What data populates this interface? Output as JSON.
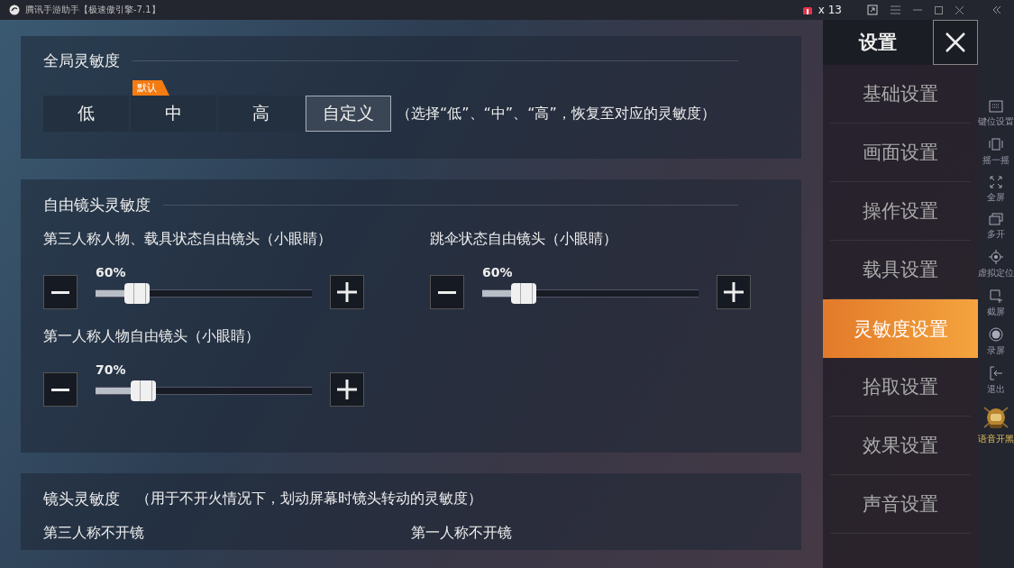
{
  "titlebar": {
    "title": "腾讯手游助手【极速傲引擎-7.1】",
    "gift_count": "x 13"
  },
  "global_sensitivity": {
    "title": "全局灵敏度",
    "hint": "（选择“低”、“中”、“高”，恢复至对应的灵敏度）",
    "options": [
      {
        "label": "低",
        "selected": false
      },
      {
        "label": "中",
        "selected": false,
        "badge": "默认"
      },
      {
        "label": "高",
        "selected": false
      },
      {
        "label": "自定义",
        "selected": true
      }
    ]
  },
  "free_camera": {
    "title": "自由镜头灵敏度",
    "sliders": [
      {
        "label": "第三人称人物、载具状态自由镜头（小眼睛）",
        "reading": "60%",
        "level": 0.19
      },
      {
        "label": "跳伞状态自由镜头（小眼睛）",
        "reading": "60%",
        "level": 0.19
      },
      {
        "label": "第一人称人物自由镜头（小眼睛）",
        "reading": "70%",
        "level": 0.22
      }
    ]
  },
  "camera": {
    "title": "镜头灵敏度",
    "note": "（用于不开火情况下，划动屏幕时镜头转动的灵敏度）",
    "columns": [
      "第三人称不开镜",
      "第一人称不开镜"
    ]
  },
  "settings_menu": {
    "title": "设置",
    "items": [
      {
        "label": "基础设置",
        "selected": false
      },
      {
        "label": "画面设置",
        "selected": false
      },
      {
        "label": "操作设置",
        "selected": false
      },
      {
        "label": "载具设置",
        "selected": false
      },
      {
        "label": "灵敏度设置",
        "selected": true
      },
      {
        "label": "拾取设置",
        "selected": false
      },
      {
        "label": "效果设置",
        "selected": false
      },
      {
        "label": "声音设置",
        "selected": false
      }
    ]
  },
  "toolbar": [
    {
      "label": "键位设置",
      "kind": "keyboard"
    },
    {
      "label": "摇一摇",
      "kind": "shake"
    },
    {
      "label": "全屏",
      "kind": "fullscreen"
    },
    {
      "label": "多开",
      "kind": "multi"
    },
    {
      "label": "虚拟定位",
      "kind": "location"
    },
    {
      "label": "截屏",
      "kind": "screenshot"
    },
    {
      "label": "录屏",
      "kind": "record"
    },
    {
      "label": "退出",
      "kind": "exit"
    },
    {
      "label": "语音开黑",
      "kind": "voice"
    }
  ]
}
